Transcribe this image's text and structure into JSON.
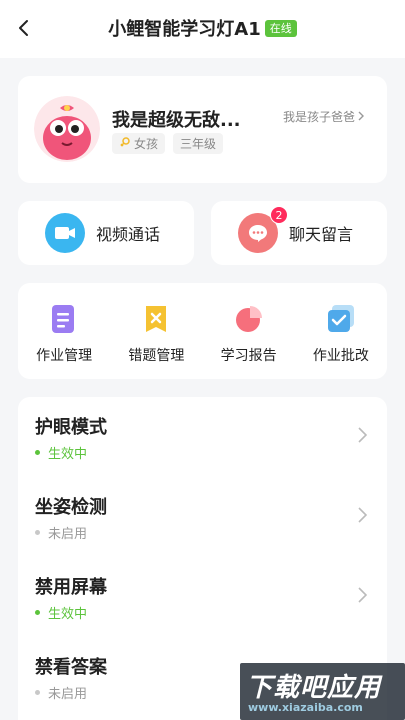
{
  "header": {
    "title": "小鲤智能学习灯A1",
    "status_badge": "在线"
  },
  "profile": {
    "name": "我是超级无敌...",
    "role_link": "我是孩子爸爸",
    "gender_tag": "女孩",
    "grade_tag": "三年级"
  },
  "actions": {
    "video": {
      "label": "视频通话",
      "color": "#3ab6f0"
    },
    "chat": {
      "label": "聊天留言",
      "color": "#f2797a",
      "badge": "2"
    }
  },
  "tools": [
    {
      "label": "作业管理",
      "icon": "homework-icon"
    },
    {
      "label": "错题管理",
      "icon": "mistakes-icon"
    },
    {
      "label": "学习报告",
      "icon": "report-icon"
    },
    {
      "label": "作业批改",
      "icon": "grading-icon"
    }
  ],
  "settings": [
    {
      "name": "护眼模式",
      "status": "生效中",
      "active": true
    },
    {
      "name": "坐姿检测",
      "status": "未启用",
      "active": false
    },
    {
      "name": "禁用屏幕",
      "status": "生效中",
      "active": true
    },
    {
      "name": "禁看答案",
      "status": "未启用",
      "active": false
    }
  ],
  "colors": {
    "accent_green": "#5cc33c",
    "inactive_gray": "#999999"
  },
  "watermark": {
    "main": "下载吧应用",
    "url": "www.xiazaiba.com"
  }
}
